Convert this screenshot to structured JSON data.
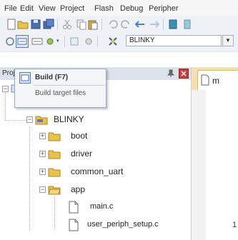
{
  "menubar": {
    "items": [
      "File",
      "Edit",
      "View",
      "Project",
      "Flash",
      "Debug",
      "Peripher"
    ]
  },
  "toolbar2": {
    "target": "BLINKY"
  },
  "project_panel": {
    "title": "Project"
  },
  "tooltip": {
    "title": "Build (F7)",
    "description": "Build target files"
  },
  "tree": {
    "target": "BLINKY",
    "groups": [
      "boot",
      "driver",
      "common_uart",
      "app"
    ],
    "files": [
      "main.c",
      "user_periph_setup.c"
    ]
  },
  "editor": {
    "tab_label": "m",
    "line_number": "1"
  },
  "colors": {
    "folder": "#e8c24a",
    "editor_tab_strip": "#f5deb3",
    "panel_header": "#dbe2ec"
  }
}
